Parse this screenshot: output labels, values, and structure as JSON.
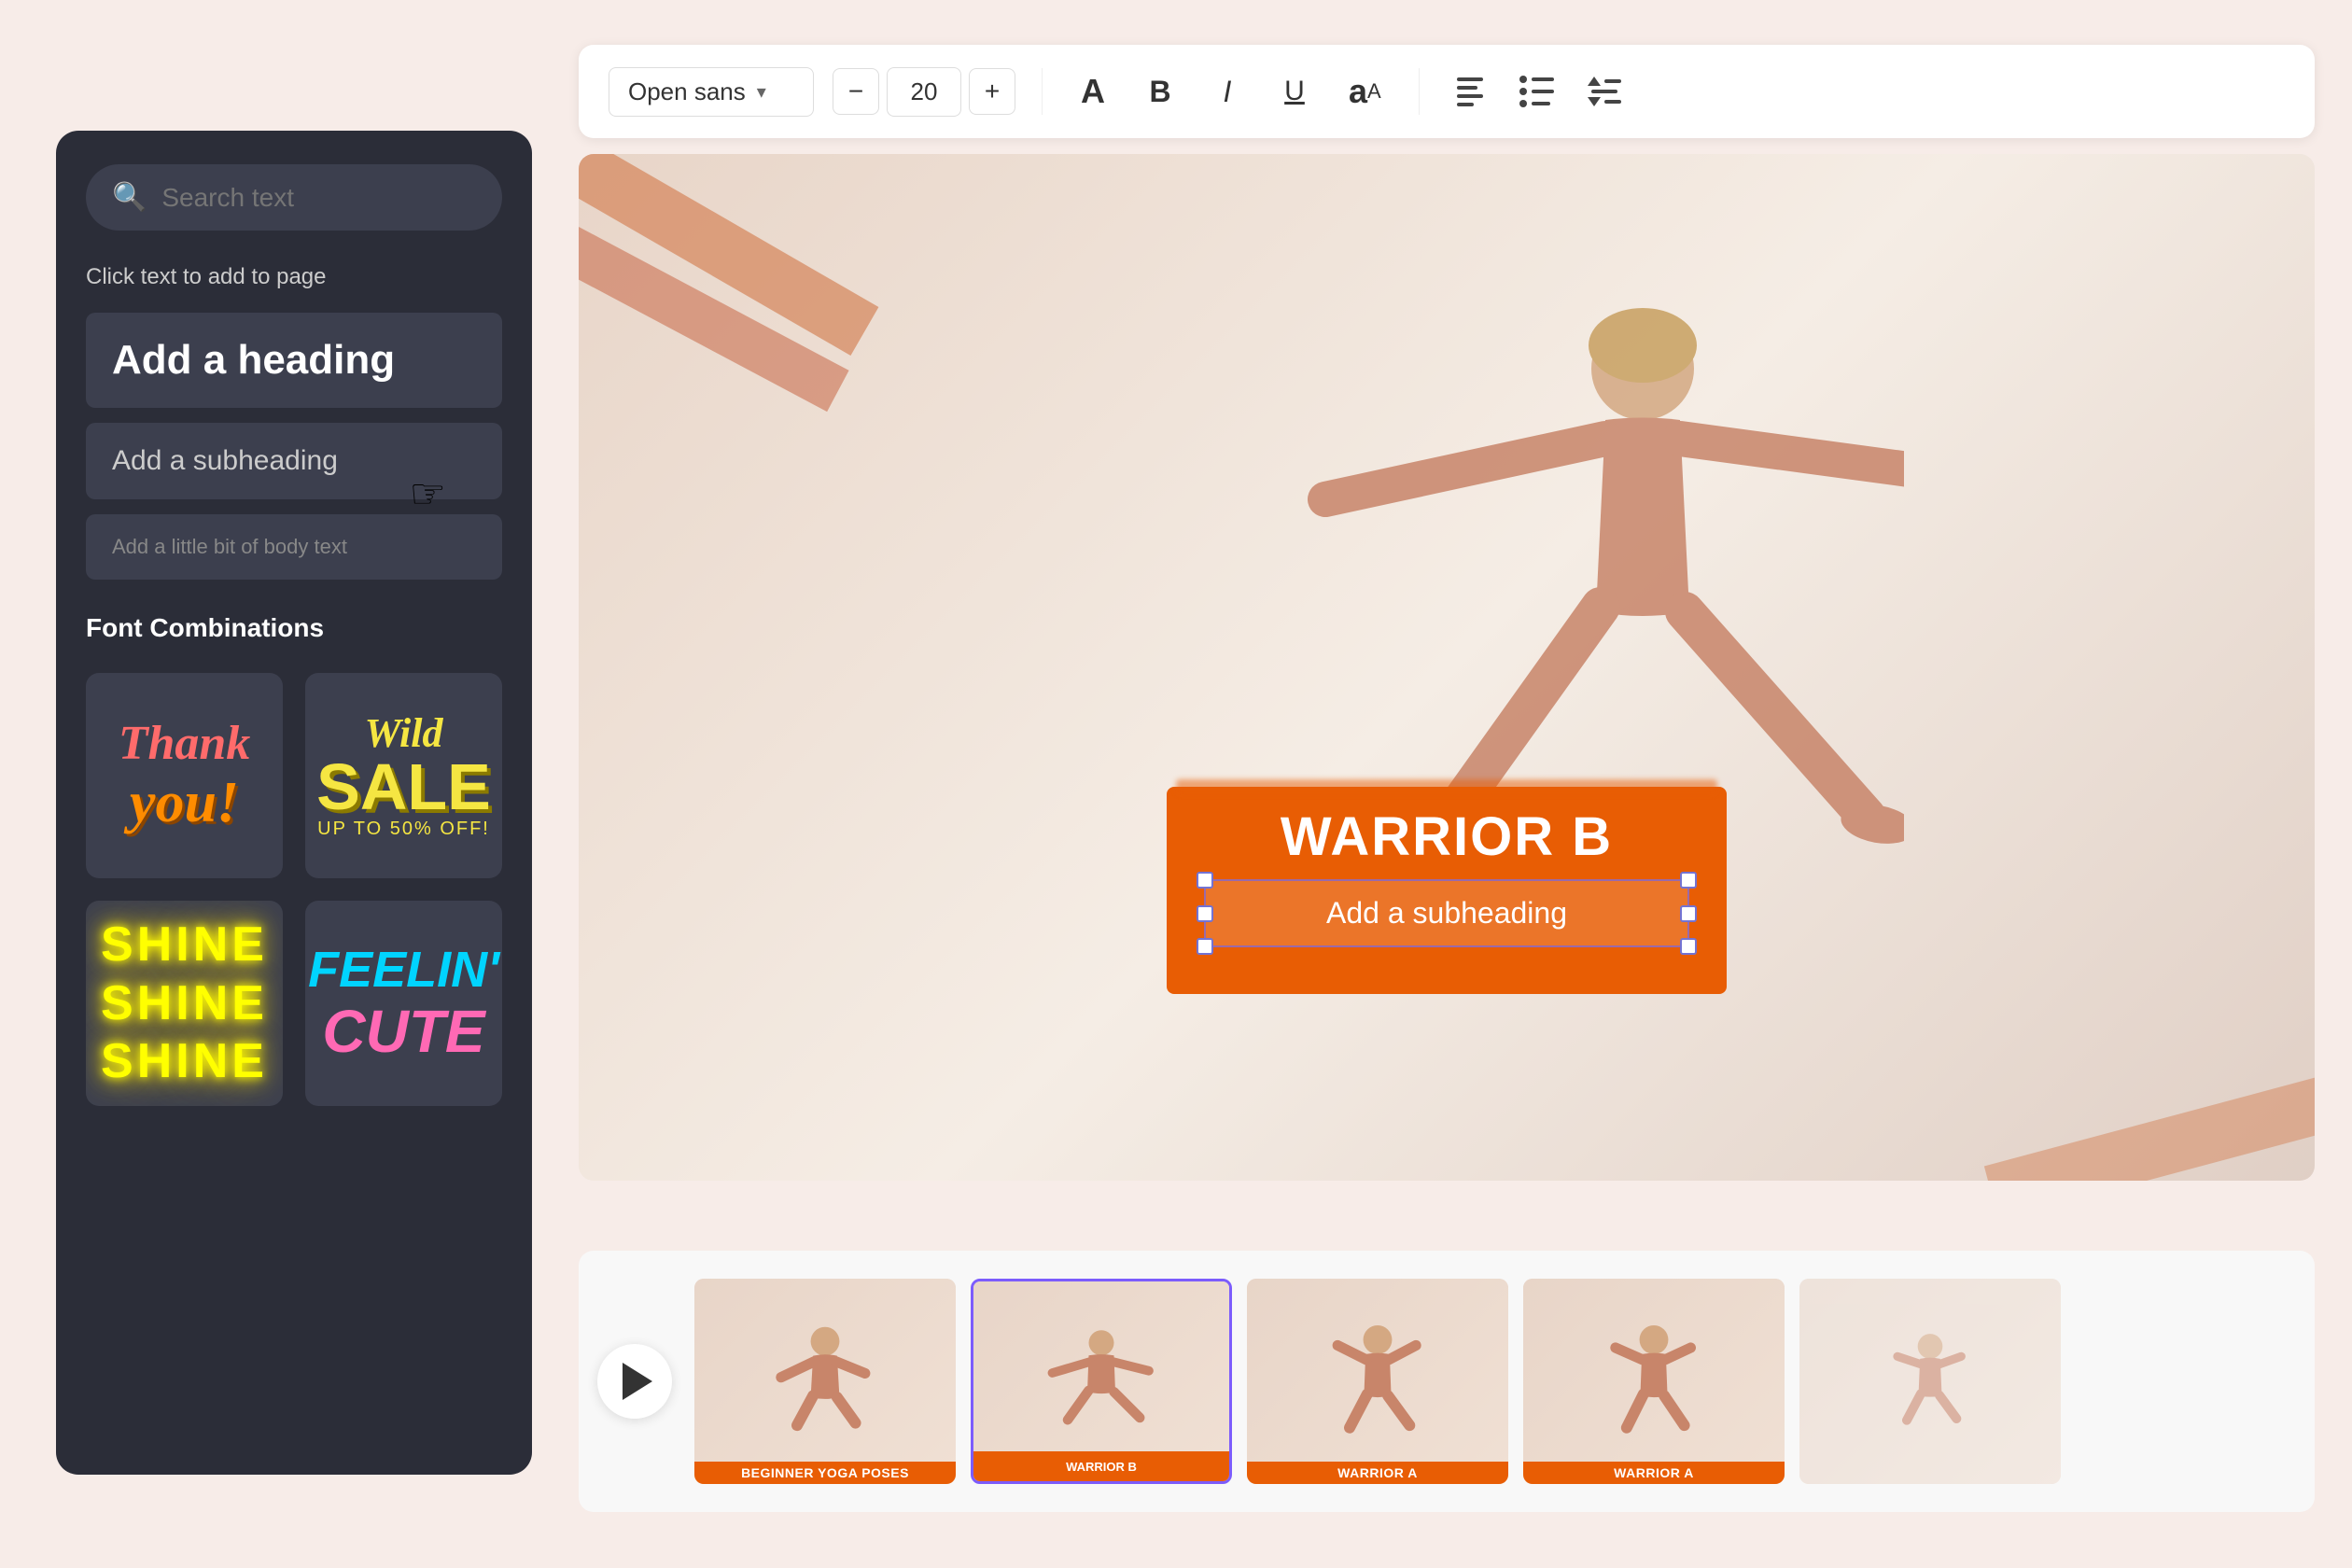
{
  "toolbar": {
    "font_name": "Open sans",
    "font_size": "20",
    "btn_minus": "−",
    "btn_plus": "+",
    "btn_A_large": "A",
    "btn_bold": "B",
    "btn_italic": "I",
    "btn_underline": "U"
  },
  "left_panel": {
    "search_placeholder": "Search text",
    "click_label": "Click text to add to page",
    "heading_label": "Add a heading",
    "subheading_label": "Add a subheading",
    "body_label": "Add a little bit of body text",
    "font_combinations_label": "Font Combinations",
    "card1_line1": "Thank",
    "card1_line2": "you!",
    "card2_line1": "Wild",
    "card2_line2": "SALE",
    "card2_line3": "UP TO 50% OFF!",
    "card3_line1": "SHINE",
    "card3_line2": "SHINE",
    "card3_line3": "SHINE",
    "card4_line1": "FEELIN'",
    "card4_line2": "CUTE"
  },
  "canvas": {
    "warrior_title": "WARRIOR B",
    "warrior_subheading": "Add a subheading"
  },
  "timeline": {
    "thumb1_label": "BEGINNER YOGA POSES",
    "thumb2_label": "WARRIOR B",
    "thumb3_label": "WARRIOR A",
    "thumb4_label": "WARRIOR A"
  }
}
